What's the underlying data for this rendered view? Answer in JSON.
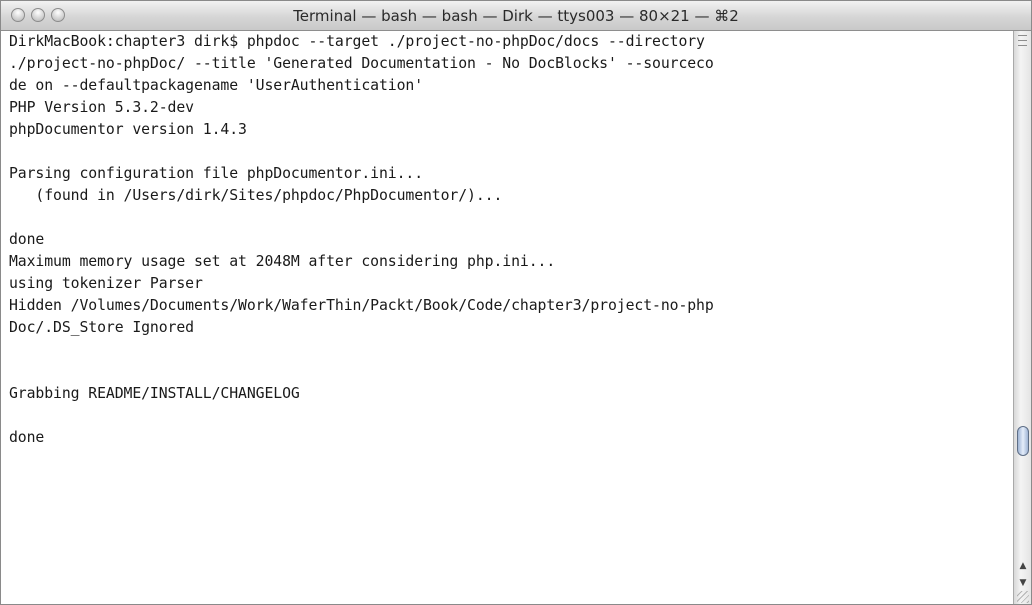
{
  "window": {
    "title": "Terminal — bash — bash — Dirk — ttys003 — 80×21 — ⌘2"
  },
  "terminal": {
    "lines": [
      "DirkMacBook:chapter3 dirk$ phpdoc --target ./project-no-phpDoc/docs --directory",
      "./project-no-phpDoc/ --title 'Generated Documentation - No DocBlocks' --sourceco",
      "de on --defaultpackagename 'UserAuthentication'",
      "PHP Version 5.3.2-dev",
      "phpDocumentor version 1.4.3",
      "",
      "Parsing configuration file phpDocumentor.ini...",
      "   (found in /Users/dirk/Sites/phpdoc/PhpDocumentor/)...",
      "",
      "done",
      "Maximum memory usage set at 2048M after considering php.ini...",
      "using tokenizer Parser",
      "Hidden /Volumes/Documents/Work/WaferThin/Packt/Book/Code/chapter3/project-no-php",
      "Doc/.DS_Store Ignored",
      "",
      "",
      "Grabbing README/INSTALL/CHANGELOG",
      "",
      "done",
      "",
      ""
    ]
  },
  "scrollbar": {
    "up_arrow": "▲",
    "down_arrow": "▼"
  },
  "icons": {
    "close": "close-button-icon",
    "minimize": "minimize-button-icon",
    "zoom": "zoom-button-icon"
  }
}
